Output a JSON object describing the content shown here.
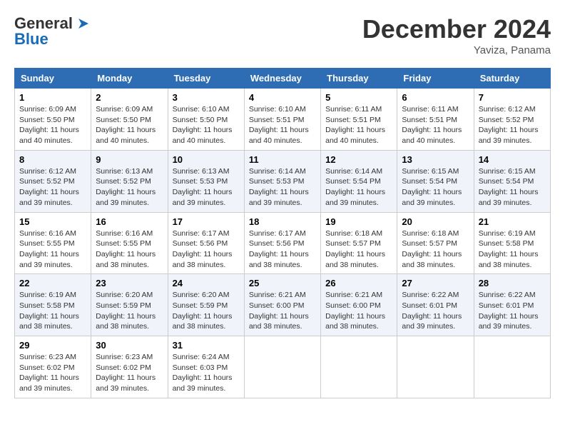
{
  "header": {
    "logo_line1": "General",
    "logo_line2": "Blue",
    "month_title": "December 2024",
    "location": "Yaviza, Panama"
  },
  "weekdays": [
    "Sunday",
    "Monday",
    "Tuesday",
    "Wednesday",
    "Thursday",
    "Friday",
    "Saturday"
  ],
  "weeks": [
    [
      {
        "day": "1",
        "sunrise": "6:09 AM",
        "sunset": "5:50 PM",
        "daylight": "11 hours and 40 minutes."
      },
      {
        "day": "2",
        "sunrise": "6:09 AM",
        "sunset": "5:50 PM",
        "daylight": "11 hours and 40 minutes."
      },
      {
        "day": "3",
        "sunrise": "6:10 AM",
        "sunset": "5:50 PM",
        "daylight": "11 hours and 40 minutes."
      },
      {
        "day": "4",
        "sunrise": "6:10 AM",
        "sunset": "5:51 PM",
        "daylight": "11 hours and 40 minutes."
      },
      {
        "day": "5",
        "sunrise": "6:11 AM",
        "sunset": "5:51 PM",
        "daylight": "11 hours and 40 minutes."
      },
      {
        "day": "6",
        "sunrise": "6:11 AM",
        "sunset": "5:51 PM",
        "daylight": "11 hours and 40 minutes."
      },
      {
        "day": "7",
        "sunrise": "6:12 AM",
        "sunset": "5:52 PM",
        "daylight": "11 hours and 39 minutes."
      }
    ],
    [
      {
        "day": "8",
        "sunrise": "6:12 AM",
        "sunset": "5:52 PM",
        "daylight": "11 hours and 39 minutes."
      },
      {
        "day": "9",
        "sunrise": "6:13 AM",
        "sunset": "5:52 PM",
        "daylight": "11 hours and 39 minutes."
      },
      {
        "day": "10",
        "sunrise": "6:13 AM",
        "sunset": "5:53 PM",
        "daylight": "11 hours and 39 minutes."
      },
      {
        "day": "11",
        "sunrise": "6:14 AM",
        "sunset": "5:53 PM",
        "daylight": "11 hours and 39 minutes."
      },
      {
        "day": "12",
        "sunrise": "6:14 AM",
        "sunset": "5:54 PM",
        "daylight": "11 hours and 39 minutes."
      },
      {
        "day": "13",
        "sunrise": "6:15 AM",
        "sunset": "5:54 PM",
        "daylight": "11 hours and 39 minutes."
      },
      {
        "day": "14",
        "sunrise": "6:15 AM",
        "sunset": "5:54 PM",
        "daylight": "11 hours and 39 minutes."
      }
    ],
    [
      {
        "day": "15",
        "sunrise": "6:16 AM",
        "sunset": "5:55 PM",
        "daylight": "11 hours and 39 minutes."
      },
      {
        "day": "16",
        "sunrise": "6:16 AM",
        "sunset": "5:55 PM",
        "daylight": "11 hours and 38 minutes."
      },
      {
        "day": "17",
        "sunrise": "6:17 AM",
        "sunset": "5:56 PM",
        "daylight": "11 hours and 38 minutes."
      },
      {
        "day": "18",
        "sunrise": "6:17 AM",
        "sunset": "5:56 PM",
        "daylight": "11 hours and 38 minutes."
      },
      {
        "day": "19",
        "sunrise": "6:18 AM",
        "sunset": "5:57 PM",
        "daylight": "11 hours and 38 minutes."
      },
      {
        "day": "20",
        "sunrise": "6:18 AM",
        "sunset": "5:57 PM",
        "daylight": "11 hours and 38 minutes."
      },
      {
        "day": "21",
        "sunrise": "6:19 AM",
        "sunset": "5:58 PM",
        "daylight": "11 hours and 38 minutes."
      }
    ],
    [
      {
        "day": "22",
        "sunrise": "6:19 AM",
        "sunset": "5:58 PM",
        "daylight": "11 hours and 38 minutes."
      },
      {
        "day": "23",
        "sunrise": "6:20 AM",
        "sunset": "5:59 PM",
        "daylight": "11 hours and 38 minutes."
      },
      {
        "day": "24",
        "sunrise": "6:20 AM",
        "sunset": "5:59 PM",
        "daylight": "11 hours and 38 minutes."
      },
      {
        "day": "25",
        "sunrise": "6:21 AM",
        "sunset": "6:00 PM",
        "daylight": "11 hours and 38 minutes."
      },
      {
        "day": "26",
        "sunrise": "6:21 AM",
        "sunset": "6:00 PM",
        "daylight": "11 hours and 38 minutes."
      },
      {
        "day": "27",
        "sunrise": "6:22 AM",
        "sunset": "6:01 PM",
        "daylight": "11 hours and 39 minutes."
      },
      {
        "day": "28",
        "sunrise": "6:22 AM",
        "sunset": "6:01 PM",
        "daylight": "11 hours and 39 minutes."
      }
    ],
    [
      {
        "day": "29",
        "sunrise": "6:23 AM",
        "sunset": "6:02 PM",
        "daylight": "11 hours and 39 minutes."
      },
      {
        "day": "30",
        "sunrise": "6:23 AM",
        "sunset": "6:02 PM",
        "daylight": "11 hours and 39 minutes."
      },
      {
        "day": "31",
        "sunrise": "6:24 AM",
        "sunset": "6:03 PM",
        "daylight": "11 hours and 39 minutes."
      },
      null,
      null,
      null,
      null
    ]
  ],
  "labels": {
    "sunrise": "Sunrise: ",
    "sunset": "Sunset: ",
    "daylight": "Daylight: "
  }
}
